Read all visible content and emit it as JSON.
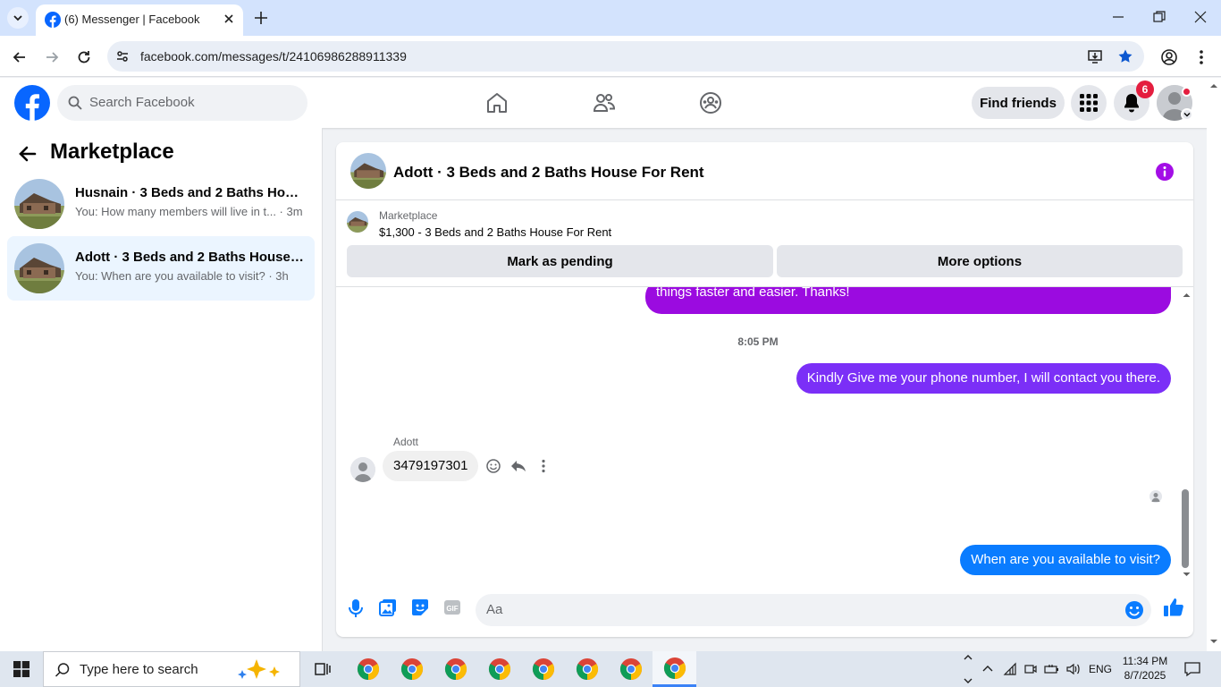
{
  "browser": {
    "tab_title": "(6) Messenger | Facebook",
    "url": "facebook.com/messages/t/24106986288911339"
  },
  "fb": {
    "search_placeholder": "Search Facebook",
    "find_friends": "Find friends",
    "notification_count": "6"
  },
  "sidebar": {
    "title": "Marketplace",
    "conversations": [
      {
        "name": "Husnain · 3 Beds and 2 Baths House For Rent",
        "preview": "You: How many members will live in t... · 3m",
        "active": false
      },
      {
        "name": "Adott · 3 Beds and 2 Baths House For Rent",
        "preview": "You: When are you available to visit? · 3h",
        "active": true
      }
    ]
  },
  "chat": {
    "title": "Adott · 3 Beds and 2 Baths House For Rent",
    "listing_source": "Marketplace",
    "listing_price": "$1,300 - 3 Beds and 2 Baths House For Rent",
    "mark_pending": "Mark as pending",
    "more_options": "More options",
    "messages": {
      "partial_out": "things faster and easier. Thanks!",
      "time": "8:05 PM",
      "out1": "Kindly Give me your phone number, I will contact you there.",
      "sender": "Adott",
      "in1": "3479197301",
      "out2": "When are you available to visit?"
    },
    "composer_placeholder": "Aa"
  },
  "taskbar": {
    "search_placeholder": "Type here to search",
    "lang": "ENG",
    "time": "11:34 PM",
    "date": "8/7/2025"
  },
  "colors": {
    "fb_blue": "#0866ff",
    "messenger_purple": "#9b0be0",
    "outgoing_blue": "#0a7cff"
  }
}
